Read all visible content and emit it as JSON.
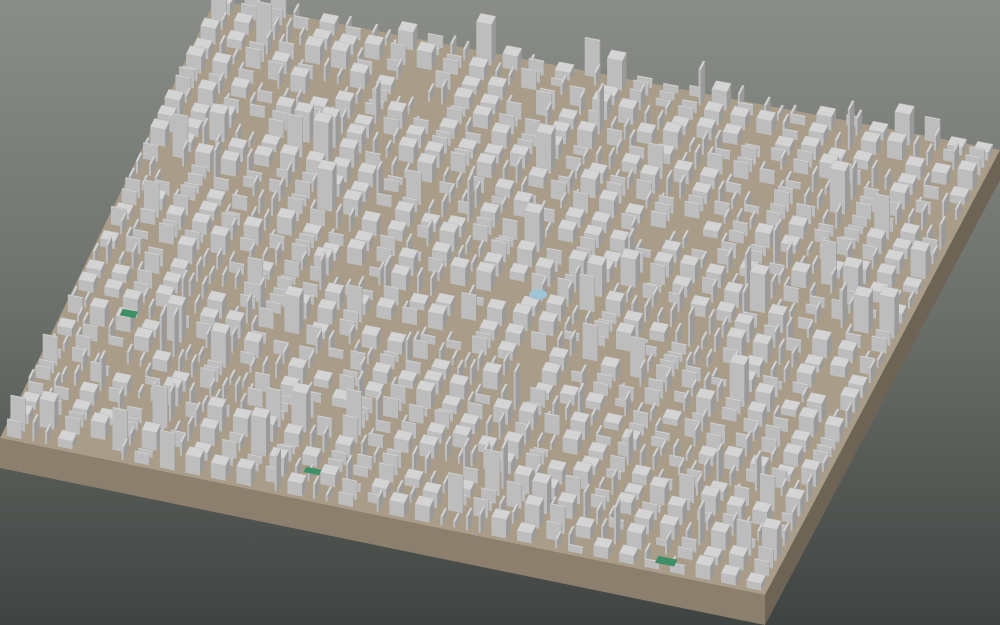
{
  "scene": {
    "colors": {
      "background_top": "#8a8d88",
      "background_mid": "#6c706b",
      "background_bottom": "#3f4442",
      "ground": "#a99c88",
      "base_front": "#8c7f6d",
      "base_side": "#6e6456",
      "roof": "#d4d4d4",
      "wall_light": "#bdbdbd",
      "wall_dark": "#9a9a9a",
      "park": "#3f8f66",
      "water": "#9fc4d6"
    }
  }
}
